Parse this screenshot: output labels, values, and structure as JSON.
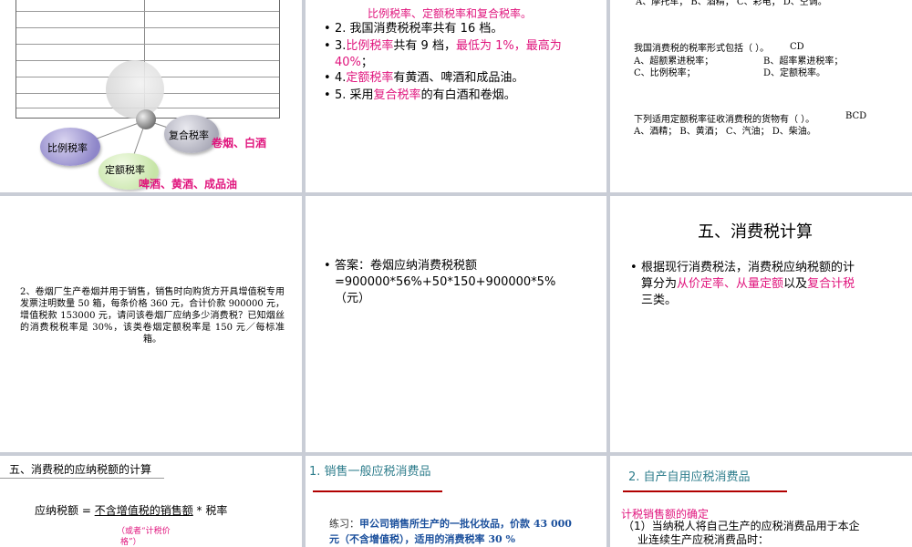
{
  "slide1": {
    "bubble_proportional": "比例税率",
    "bubble_fixed": "定额税率",
    "bubble_compound": "复合税率",
    "label_compound_items": "卷烟、白酒",
    "label_fixed_items": "啤酒、黄酒、成品油"
  },
  "slide2": {
    "top_partial": "比例税率、定额税率和复合税率。",
    "b2": "2. 我国消费税税率共有 16 档。",
    "b3_pre": "3.",
    "b3_pink1": "比例税率",
    "b3_mid": "共有 9 档，",
    "b3_pink2": "最低为 1%，最高为",
    "b3_pink3": "40%",
    "b3_end": "；",
    "b4_pre": "4.",
    "b4_pink": "定额税率",
    "b4_rest": "有黄酒、啤酒和成品油。",
    "b5_pre": "5. 采用",
    "b5_pink": "复合税率",
    "b5_rest": "的有白酒和卷烟。"
  },
  "slide3": {
    "top_partial": "A、摩托车；     B、酒精；     C、彩电；  D、空调。",
    "q1": "我国消费税的税率形式包括（       ）。",
    "q1_answer": "CD",
    "q1_a": "A、超额累进税率；",
    "q1_b": "B、超率累进税率；",
    "q1_c": "C、比例税率；",
    "q1_d": "D、定额税率。",
    "q2": "下列适用定额税率征收消费税的货物有（          ）。",
    "q2_answer": "BCD",
    "q2_opts": "A、酒精；     B、黄酒；     C、汽油；     D、柴油。"
  },
  "slide4": {
    "problem": "2、卷烟厂生产卷烟并用于销售，销售时向购货方开具增值税专用发票注明数量 50 箱，每条价格 360 元，合计价款 900000 元，增值税款 153000 元，请问该卷烟厂应纳多少消费税？已知烟丝的消费税税率是 30%，该类卷烟定额税率是 150 元／每标准箱。"
  },
  "slide5": {
    "answer_line1": "答案：卷烟应纳消费税税额",
    "answer_line2": "=900000*56%+50*150+900000*5%",
    "answer_line3": "（元）"
  },
  "slide6": {
    "title": "五、消费税计算",
    "line1": "根据现行消费税法，消费税应纳税额的计",
    "line2_pre": "算分为",
    "line2_pink1": "从价定率",
    "line2_sep": "、",
    "line2_pink2": "从量定额",
    "line2_mid": "以及",
    "line2_pink3": "复合计税",
    "line3": "三类。"
  },
  "slide7": {
    "title": "五、消费税的应纳税额的计算",
    "formula_pre": "应纳税额 = ",
    "formula_u": "不含增值税的销售额",
    "formula_post": " * 税率",
    "note_line1": "（或者“计税价",
    "note_line2": "格”）"
  },
  "slide8": {
    "title": "1. 销售一般应税消费品",
    "ex_label": "练习：",
    "ex_line1": "甲公司销售所生产的一批化妆品，价款 43 000",
    "ex_line2": "元（不含增值税），适用的消费税率 30 %"
  },
  "slide9": {
    "title": "2. 自产自用应税消费品",
    "subtitle": "计税销售额的确定",
    "line1": "（1）当纳税人将自己生产的应税消费品用于本企",
    "line2": "业连续生产应税消费品时："
  },
  "colors": {
    "pink": "#e0157d",
    "teal": "#2e7d8c",
    "background": "#c9cdd6"
  }
}
